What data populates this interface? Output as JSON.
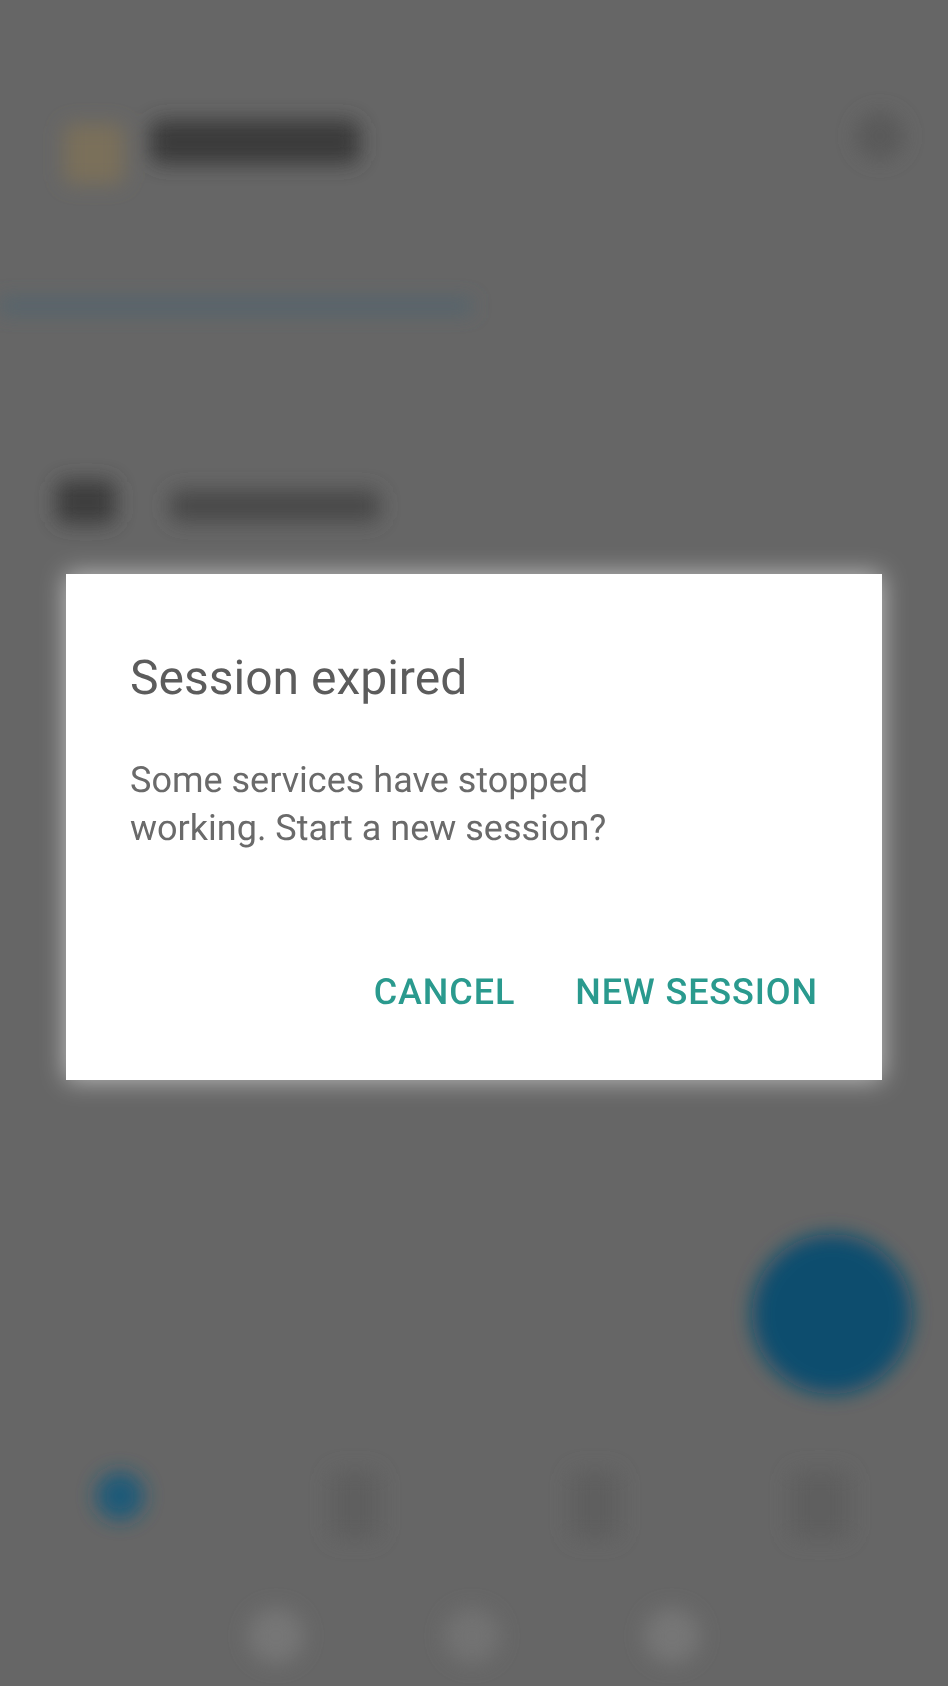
{
  "dialog": {
    "title": "Session expired",
    "message": "Some services have stopped working. Start a new session?",
    "buttons": [
      {
        "label": "CANCEL"
      },
      {
        "label": "NEW SESSION"
      }
    ]
  }
}
